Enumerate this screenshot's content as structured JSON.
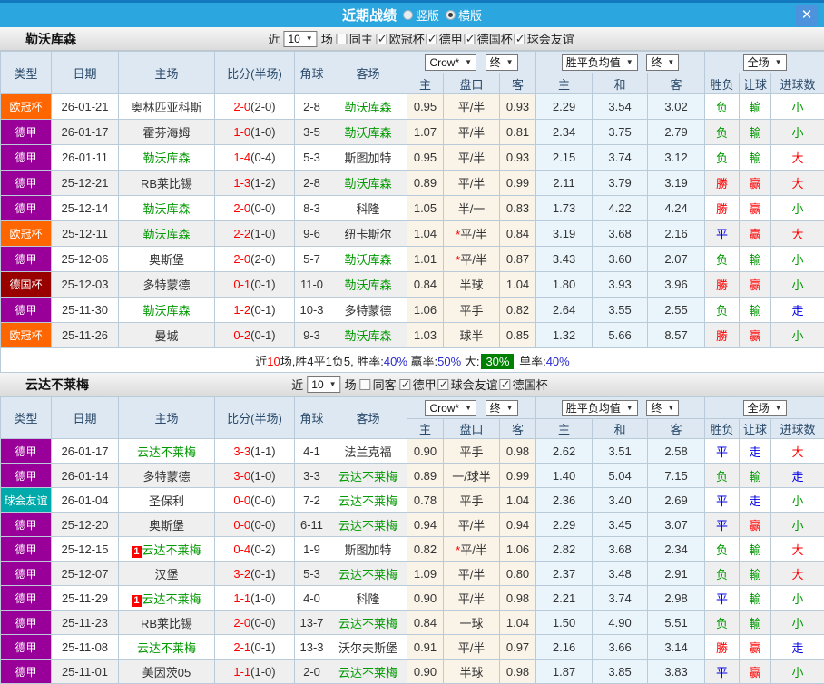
{
  "titlebar": {
    "title": "近期战绩",
    "radio_vertical": "竖版",
    "radio_horizontal": "横版",
    "close_icon": "✕"
  },
  "table_header": {
    "cols_left": [
      "类型",
      "日期",
      "主场",
      "比分(半场)",
      "角球",
      "客场"
    ],
    "sub_cols": [
      "主",
      "盘口",
      "客",
      "主",
      "和",
      "客",
      "胜负",
      "让球",
      "进球数"
    ],
    "odds_source": "Crow*",
    "final_label": "终",
    "avg_label": "胜平负均值",
    "fullmatch_label": "全场"
  },
  "colors": {
    "titlebar_blue": "#2CA6DF",
    "titlebar_top_strip": "#1379BF",
    "close_button_blue": "#4C92DC",
    "header_cell_bg": "#DEE8F2",
    "league_champions": "#FF6600",
    "league_bundesliga": "#990099",
    "league_dfb_pokal": "#990000",
    "league_friendly": "#00AAAA",
    "focus_team_green": "#009900",
    "score_red": "#FF0000",
    "win_red": "#FF0000",
    "lose_green": "#009900",
    "draw_blue": "#0000E6",
    "odds_col_bg": "#FAF3E8",
    "avg_col_bg": "#EAF4FB",
    "stripe_gray": "#EFEFEF",
    "summary_pct_blue": "#2929CC",
    "summary_big_bg": "#008000"
  },
  "sections": [
    {
      "team": "勒沃库森",
      "near_label": "近",
      "match_count": "10",
      "games_label": "场",
      "same_label": "同主",
      "same_checked": false,
      "filters": [
        {
          "label": "欧冠杯",
          "checked": true
        },
        {
          "label": "德甲",
          "checked": true
        },
        {
          "label": "德国杯",
          "checked": true
        },
        {
          "label": "球会友谊",
          "checked": true
        }
      ],
      "rows": [
        {
          "league": "欧冠杯",
          "league_color": "#FF6600",
          "date": "26-01-21",
          "home": "奥林匹亚科斯",
          "home_focus": false,
          "home_badge": "",
          "score": "2-0",
          "half": "(2-0)",
          "corners": "2-8",
          "away": "勒沃库森",
          "away_focus": true,
          "away_badge": "",
          "odds_home": "0.95",
          "handicap": "平/半",
          "handicap_star": false,
          "odds_away": "0.93",
          "avg_home": "2.29",
          "avg_draw": "3.54",
          "avg_away": "3.02",
          "res_wdl": [
            "负",
            "g"
          ],
          "res_let": [
            "輸",
            "g"
          ],
          "res_size": [
            "小",
            "g"
          ]
        },
        {
          "league": "德甲",
          "league_color": "#990099",
          "date": "26-01-17",
          "home": "霍芬海姆",
          "home_focus": false,
          "home_badge": "",
          "score": "1-0",
          "half": "(1-0)",
          "corners": "3-5",
          "away": "勒沃库森",
          "away_focus": true,
          "away_badge": "",
          "odds_home": "1.07",
          "handicap": "平/半",
          "handicap_star": false,
          "odds_away": "0.81",
          "avg_home": "2.34",
          "avg_draw": "3.75",
          "avg_away": "2.79",
          "res_wdl": [
            "负",
            "g"
          ],
          "res_let": [
            "輸",
            "g"
          ],
          "res_size": [
            "小",
            "g"
          ]
        },
        {
          "league": "德甲",
          "league_color": "#990099",
          "date": "26-01-11",
          "home": "勒沃库森",
          "home_focus": true,
          "home_badge": "",
          "score": "1-4",
          "half": "(0-4)",
          "corners": "5-3",
          "away": "斯图加特",
          "away_focus": false,
          "away_badge": "",
          "odds_home": "0.95",
          "handicap": "平/半",
          "handicap_star": false,
          "odds_away": "0.93",
          "avg_home": "2.15",
          "avg_draw": "3.74",
          "avg_away": "3.12",
          "res_wdl": [
            "负",
            "g"
          ],
          "res_let": [
            "輸",
            "g"
          ],
          "res_size": [
            "大",
            "r"
          ]
        },
        {
          "league": "德甲",
          "league_color": "#990099",
          "date": "25-12-21",
          "home": "RB莱比锡",
          "home_focus": false,
          "home_badge": "",
          "score": "1-3",
          "half": "(1-2)",
          "corners": "2-8",
          "away": "勒沃库森",
          "away_focus": true,
          "away_badge": "",
          "odds_home": "0.89",
          "handicap": "平/半",
          "handicap_star": false,
          "odds_away": "0.99",
          "avg_home": "2.11",
          "avg_draw": "3.79",
          "avg_away": "3.19",
          "res_wdl": [
            "勝",
            "r"
          ],
          "res_let": [
            "赢",
            "r"
          ],
          "res_size": [
            "大",
            "r"
          ]
        },
        {
          "league": "德甲",
          "league_color": "#990099",
          "date": "25-12-14",
          "home": "勒沃库森",
          "home_focus": true,
          "home_badge": "",
          "score": "2-0",
          "half": "(0-0)",
          "corners": "8-3",
          "away": "科隆",
          "away_focus": false,
          "away_badge": "",
          "odds_home": "1.05",
          "handicap": "半/一",
          "handicap_star": false,
          "odds_away": "0.83",
          "avg_home": "1.73",
          "avg_draw": "4.22",
          "avg_away": "4.24",
          "res_wdl": [
            "勝",
            "r"
          ],
          "res_let": [
            "赢",
            "r"
          ],
          "res_size": [
            "小",
            "g"
          ]
        },
        {
          "league": "欧冠杯",
          "league_color": "#FF6600",
          "date": "25-12-11",
          "home": "勒沃库森",
          "home_focus": true,
          "home_badge": "",
          "score": "2-2",
          "half": "(1-0)",
          "corners": "9-6",
          "away": "纽卡斯尔",
          "away_focus": false,
          "away_badge": "",
          "odds_home": "1.04",
          "handicap": "平/半",
          "handicap_star": true,
          "odds_away": "0.84",
          "avg_home": "3.19",
          "avg_draw": "3.68",
          "avg_away": "2.16",
          "res_wdl": [
            "平",
            "b"
          ],
          "res_let": [
            "赢",
            "r"
          ],
          "res_size": [
            "大",
            "r"
          ]
        },
        {
          "league": "德甲",
          "league_color": "#990099",
          "date": "25-12-06",
          "home": "奥斯堡",
          "home_focus": false,
          "home_badge": "",
          "score": "2-0",
          "half": "(2-0)",
          "corners": "5-7",
          "away": "勒沃库森",
          "away_focus": true,
          "away_badge": "",
          "odds_home": "1.01",
          "handicap": "平/半",
          "handicap_star": true,
          "odds_away": "0.87",
          "avg_home": "3.43",
          "avg_draw": "3.60",
          "avg_away": "2.07",
          "res_wdl": [
            "负",
            "g"
          ],
          "res_let": [
            "輸",
            "g"
          ],
          "res_size": [
            "小",
            "g"
          ]
        },
        {
          "league": "德国杯",
          "league_color": "#990000",
          "date": "25-12-03",
          "home": "多特蒙德",
          "home_focus": false,
          "home_badge": "",
          "score": "0-1",
          "half": "(0-1)",
          "corners": "11-0",
          "away": "勒沃库森",
          "away_focus": true,
          "away_badge": "",
          "odds_home": "0.84",
          "handicap": "半球",
          "handicap_star": false,
          "odds_away": "1.04",
          "avg_home": "1.80",
          "avg_draw": "3.93",
          "avg_away": "3.96",
          "res_wdl": [
            "勝",
            "r"
          ],
          "res_let": [
            "赢",
            "r"
          ],
          "res_size": [
            "小",
            "g"
          ]
        },
        {
          "league": "德甲",
          "league_color": "#990099",
          "date": "25-11-30",
          "home": "勒沃库森",
          "home_focus": true,
          "home_badge": "",
          "score": "1-2",
          "half": "(0-1)",
          "corners": "10-3",
          "away": "多特蒙德",
          "away_focus": false,
          "away_badge": "",
          "odds_home": "1.06",
          "handicap": "平手",
          "handicap_star": false,
          "odds_away": "0.82",
          "avg_home": "2.64",
          "avg_draw": "3.55",
          "avg_away": "2.55",
          "res_wdl": [
            "负",
            "g"
          ],
          "res_let": [
            "輸",
            "g"
          ],
          "res_size": [
            "走",
            "b"
          ]
        },
        {
          "league": "欧冠杯",
          "league_color": "#FF6600",
          "date": "25-11-26",
          "home": "曼城",
          "home_focus": false,
          "home_badge": "",
          "score": "0-2",
          "half": "(0-1)",
          "corners": "9-3",
          "away": "勒沃库森",
          "away_focus": true,
          "away_badge": "",
          "odds_home": "1.03",
          "handicap": "球半",
          "handicap_star": false,
          "odds_away": "0.85",
          "avg_home": "1.32",
          "avg_draw": "5.66",
          "avg_away": "8.57",
          "res_wdl": [
            "勝",
            "r"
          ],
          "res_let": [
            "赢",
            "r"
          ],
          "res_size": [
            "小",
            "g"
          ]
        }
      ],
      "summary": [
        [
          "近",
          "k"
        ],
        [
          "10",
          "r"
        ],
        [
          "场,胜4平1负5, 胜率:",
          "k"
        ],
        [
          "40%",
          "b"
        ],
        [
          " 赢率:",
          "k"
        ],
        [
          "50%",
          "b"
        ],
        [
          " 大:",
          "k"
        ],
        [
          "30%",
          "gbg"
        ],
        [
          " 单率:",
          "k"
        ],
        [
          "40%",
          "b"
        ]
      ]
    },
    {
      "team": "云达不莱梅",
      "near_label": "近",
      "match_count": "10",
      "games_label": "场",
      "same_label": "同客",
      "same_checked": false,
      "filters": [
        {
          "label": "德甲",
          "checked": true
        },
        {
          "label": "球会友谊",
          "checked": true
        },
        {
          "label": "德国杯",
          "checked": true
        }
      ],
      "rows": [
        {
          "league": "德甲",
          "league_color": "#990099",
          "date": "26-01-17",
          "home": "云达不莱梅",
          "home_focus": true,
          "home_badge": "",
          "score": "3-3",
          "half": "(1-1)",
          "corners": "4-1",
          "away": "法兰克福",
          "away_focus": false,
          "away_badge": "",
          "odds_home": "0.90",
          "handicap": "平手",
          "handicap_star": false,
          "odds_away": "0.98",
          "avg_home": "2.62",
          "avg_draw": "3.51",
          "avg_away": "2.58",
          "res_wdl": [
            "平",
            "b"
          ],
          "res_let": [
            "走",
            "b"
          ],
          "res_size": [
            "大",
            "r"
          ]
        },
        {
          "league": "德甲",
          "league_color": "#990099",
          "date": "26-01-14",
          "home": "多特蒙德",
          "home_focus": false,
          "home_badge": "",
          "score": "3-0",
          "half": "(1-0)",
          "corners": "3-3",
          "away": "云达不莱梅",
          "away_focus": true,
          "away_badge": "",
          "odds_home": "0.89",
          "handicap": "一/球半",
          "handicap_star": false,
          "odds_away": "0.99",
          "avg_home": "1.40",
          "avg_draw": "5.04",
          "avg_away": "7.15",
          "res_wdl": [
            "负",
            "g"
          ],
          "res_let": [
            "輸",
            "g"
          ],
          "res_size": [
            "走",
            "b"
          ]
        },
        {
          "league": "球会友谊",
          "league_color": "#00AAAA",
          "date": "26-01-04",
          "home": "圣保利",
          "home_focus": false,
          "home_badge": "",
          "score": "0-0",
          "half": "(0-0)",
          "corners": "7-2",
          "away": "云达不莱梅",
          "away_focus": true,
          "away_badge": "",
          "odds_home": "0.78",
          "handicap": "平手",
          "handicap_star": false,
          "odds_away": "1.04",
          "avg_home": "2.36",
          "avg_draw": "3.40",
          "avg_away": "2.69",
          "res_wdl": [
            "平",
            "b"
          ],
          "res_let": [
            "走",
            "b"
          ],
          "res_size": [
            "小",
            "g"
          ]
        },
        {
          "league": "德甲",
          "league_color": "#990099",
          "date": "25-12-20",
          "home": "奥斯堡",
          "home_focus": false,
          "home_badge": "",
          "score": "0-0",
          "half": "(0-0)",
          "corners": "6-11",
          "away": "云达不莱梅",
          "away_focus": true,
          "away_badge": "",
          "odds_home": "0.94",
          "handicap": "平/半",
          "handicap_star": false,
          "odds_away": "0.94",
          "avg_home": "2.29",
          "avg_draw": "3.45",
          "avg_away": "3.07",
          "res_wdl": [
            "平",
            "b"
          ],
          "res_let": [
            "赢",
            "r"
          ],
          "res_size": [
            "小",
            "g"
          ]
        },
        {
          "league": "德甲",
          "league_color": "#990099",
          "date": "25-12-15",
          "home": "云达不莱梅",
          "home_focus": true,
          "home_badge": "1",
          "score": "0-4",
          "half": "(0-2)",
          "corners": "1-9",
          "away": "斯图加特",
          "away_focus": false,
          "away_badge": "",
          "odds_home": "0.82",
          "handicap": "平/半",
          "handicap_star": true,
          "odds_away": "1.06",
          "avg_home": "2.82",
          "avg_draw": "3.68",
          "avg_away": "2.34",
          "res_wdl": [
            "负",
            "g"
          ],
          "res_let": [
            "輸",
            "g"
          ],
          "res_size": [
            "大",
            "r"
          ]
        },
        {
          "league": "德甲",
          "league_color": "#990099",
          "date": "25-12-07",
          "home": "汉堡",
          "home_focus": false,
          "home_badge": "",
          "score": "3-2",
          "half": "(0-1)",
          "corners": "5-3",
          "away": "云达不莱梅",
          "away_focus": true,
          "away_badge": "",
          "odds_home": "1.09",
          "handicap": "平/半",
          "handicap_star": false,
          "odds_away": "0.80",
          "avg_home": "2.37",
          "avg_draw": "3.48",
          "avg_away": "2.91",
          "res_wdl": [
            "负",
            "g"
          ],
          "res_let": [
            "輸",
            "g"
          ],
          "res_size": [
            "大",
            "r"
          ]
        },
        {
          "league": "德甲",
          "league_color": "#990099",
          "date": "25-11-29",
          "home": "云达不莱梅",
          "home_focus": true,
          "home_badge": "1",
          "score": "1-1",
          "half": "(1-0)",
          "corners": "4-0",
          "away": "科隆",
          "away_focus": false,
          "away_badge": "",
          "odds_home": "0.90",
          "handicap": "平/半",
          "handicap_star": false,
          "odds_away": "0.98",
          "avg_home": "2.21",
          "avg_draw": "3.74",
          "avg_away": "2.98",
          "res_wdl": [
            "平",
            "b"
          ],
          "res_let": [
            "輸",
            "g"
          ],
          "res_size": [
            "小",
            "g"
          ]
        },
        {
          "league": "德甲",
          "league_color": "#990099",
          "date": "25-11-23",
          "home": "RB莱比锡",
          "home_focus": false,
          "home_badge": "",
          "score": "2-0",
          "half": "(0-0)",
          "corners": "13-7",
          "away": "云达不莱梅",
          "away_focus": true,
          "away_badge": "",
          "odds_home": "0.84",
          "handicap": "一球",
          "handicap_star": false,
          "odds_away": "1.04",
          "avg_home": "1.50",
          "avg_draw": "4.90",
          "avg_away": "5.51",
          "res_wdl": [
            "负",
            "g"
          ],
          "res_let": [
            "輸",
            "g"
          ],
          "res_size": [
            "小",
            "g"
          ]
        },
        {
          "league": "德甲",
          "league_color": "#990099",
          "date": "25-11-08",
          "home": "云达不莱梅",
          "home_focus": true,
          "home_badge": "",
          "score": "2-1",
          "half": "(0-1)",
          "corners": "13-3",
          "away": "沃尔夫斯堡",
          "away_focus": false,
          "away_badge": "",
          "odds_home": "0.91",
          "handicap": "平/半",
          "handicap_star": false,
          "odds_away": "0.97",
          "avg_home": "2.16",
          "avg_draw": "3.66",
          "avg_away": "3.14",
          "res_wdl": [
            "勝",
            "r"
          ],
          "res_let": [
            "赢",
            "r"
          ],
          "res_size": [
            "走",
            "b"
          ]
        },
        {
          "league": "德甲",
          "league_color": "#990099",
          "date": "25-11-01",
          "home": "美因茨05",
          "home_focus": false,
          "home_badge": "",
          "score": "1-1",
          "half": "(1-0)",
          "corners": "2-0",
          "away": "云达不莱梅",
          "away_focus": true,
          "away_badge": "",
          "odds_home": "0.90",
          "handicap": "半球",
          "handicap_star": false,
          "odds_away": "0.98",
          "avg_home": "1.87",
          "avg_draw": "3.85",
          "avg_away": "3.83",
          "res_wdl": [
            "平",
            "b"
          ],
          "res_let": [
            "赢",
            "r"
          ],
          "res_size": [
            "小",
            "g"
          ]
        }
      ],
      "summary": []
    }
  ]
}
